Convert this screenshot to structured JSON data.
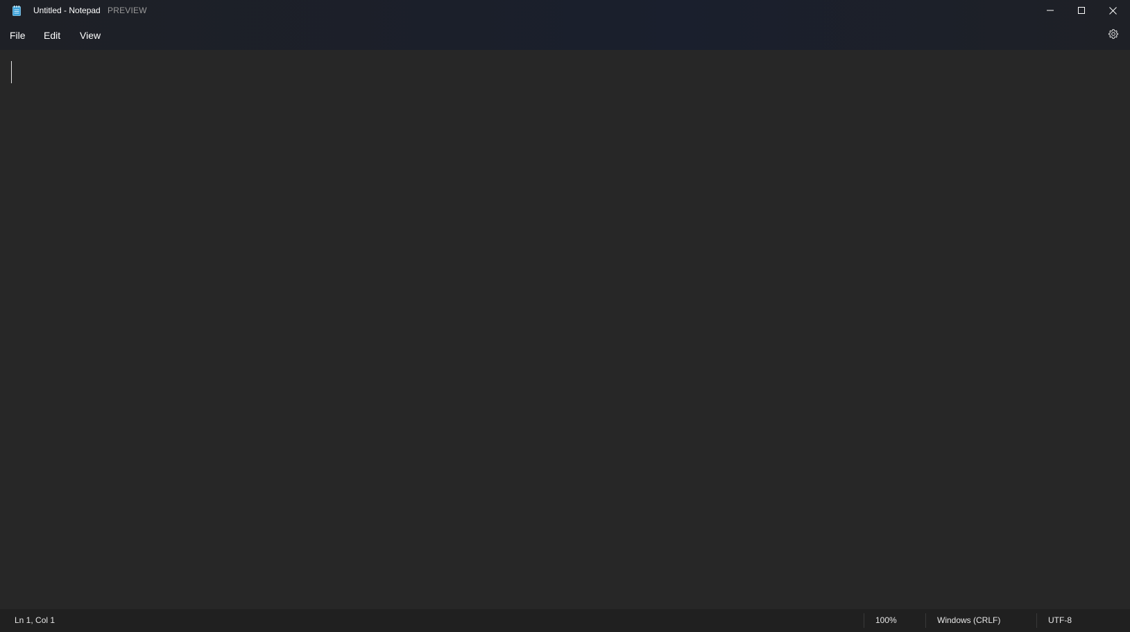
{
  "window": {
    "title": "Untitled - Notepad",
    "badge": "PREVIEW",
    "app_icon": "notepad-icon",
    "controls": {
      "minimize": "minimize-icon",
      "maximize": "maximize-icon",
      "close": "close-icon"
    }
  },
  "menu": {
    "items": [
      {
        "label": "File"
      },
      {
        "label": "Edit"
      },
      {
        "label": "View"
      }
    ],
    "settings_icon": "gear-icon"
  },
  "editor": {
    "content": ""
  },
  "status": {
    "position": "Ln 1, Col 1",
    "zoom": "100%",
    "line_ending": "Windows (CRLF)",
    "encoding": "UTF-8"
  },
  "colors": {
    "titlebar": "#1b1f2a",
    "editor_background": "#272727",
    "statusbar": "#202020",
    "icon_accent": "#4fc3f7"
  }
}
